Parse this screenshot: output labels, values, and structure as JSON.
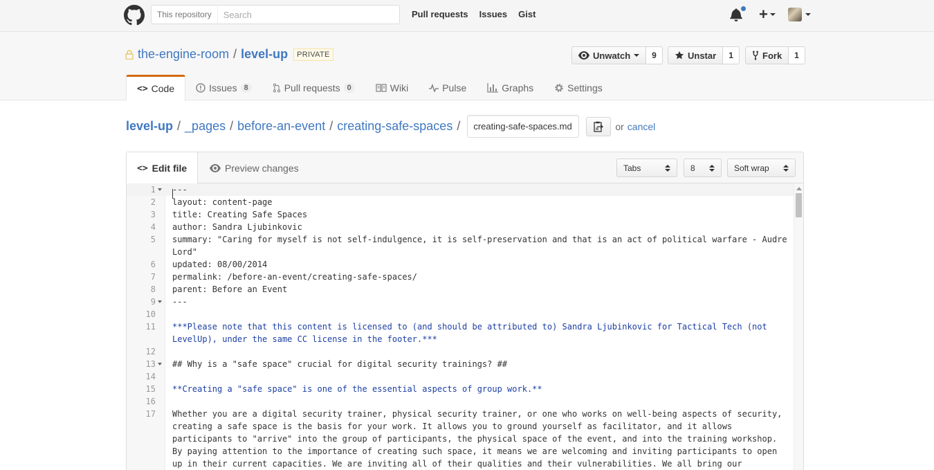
{
  "header": {
    "search_scope": "This repository",
    "search_placeholder": "Search",
    "nav": [
      "Pull requests",
      "Issues",
      "Gist"
    ]
  },
  "repo": {
    "owner": "the-engine-room",
    "separator": "/",
    "name": "level-up",
    "visibility": "PRIVATE",
    "watch": {
      "label": "Unwatch",
      "count": "9"
    },
    "star": {
      "label": "Unstar",
      "count": "1"
    },
    "fork": {
      "label": "Fork",
      "count": "1"
    },
    "tabs": [
      {
        "label": "Code",
        "selected": true
      },
      {
        "label": "Issues",
        "counter": "8"
      },
      {
        "label": "Pull requests",
        "counter": "0"
      },
      {
        "label": "Wiki"
      },
      {
        "label": "Pulse"
      },
      {
        "label": "Graphs"
      },
      {
        "label": "Settings"
      }
    ]
  },
  "breadcrumb": {
    "root": "level-up",
    "parts": [
      "_pages",
      "before-an-event",
      "creating-safe-spaces"
    ],
    "sep": "/",
    "filename": "creating-safe-spaces.md",
    "or": "or",
    "cancel": "cancel"
  },
  "editor": {
    "tab_edit": "Edit file",
    "tab_preview": "Preview changes",
    "indent_mode": "Tabs",
    "indent_size": "8",
    "wrap_mode": "Soft wrap",
    "lines": [
      {
        "n": "1",
        "fold": true,
        "text": "---"
      },
      {
        "n": "2",
        "text": "layout: content-page"
      },
      {
        "n": "3",
        "text": "title: Creating Safe Spaces"
      },
      {
        "n": "4",
        "text": "author: Sandra Ljubinkovic"
      },
      {
        "n": "5",
        "rows": 2,
        "text": "summary: \"Caring for myself is not self-indulgence, it is self-preservation and that is an act of political warfare - Audre\nLord\""
      },
      {
        "n": "6",
        "text": "updated: 08/00/2014"
      },
      {
        "n": "7",
        "text": "permalink: /before-an-event/creating-safe-spaces/"
      },
      {
        "n": "8",
        "text": "parent: Before an Event"
      },
      {
        "n": "9",
        "fold": true,
        "text": "---"
      },
      {
        "n": "10",
        "text": ""
      },
      {
        "n": "11",
        "rows": 2,
        "blue": true,
        "text": "***Please note that this content is licensed to (and should be attributed to) Sandra Ljubinkovic for Tactical Tech (not\nLevelUp), under the same CC license in the footer.***"
      },
      {
        "n": "12",
        "text": ""
      },
      {
        "n": "13",
        "fold": true,
        "text": "## Why is a \"safe space\" crucial for digital security trainings? ##"
      },
      {
        "n": "14",
        "text": ""
      },
      {
        "n": "15",
        "blue": true,
        "text": "**Creating a \"safe space\" is one of the essential aspects of group work.**"
      },
      {
        "n": "16",
        "text": ""
      },
      {
        "n": "17",
        "rows": 5,
        "text": "Whether you are a digital security trainer, physical security trainer, or one who works on well-being aspects of security,\ncreating a safe space is the basis for your work. It allows you to ground yourself as facilitator, and it allows\nparticipants to \"arrive\" into the group of participants, the physical space of the event, and into the training workshop.\nBy paying attention to the importance of creating such space, it means we are welcoming and inviting participants to open\nup in their current capacities. We are inviting all of their qualities and their vulnerabilities. We all bring our"
      }
    ]
  }
}
